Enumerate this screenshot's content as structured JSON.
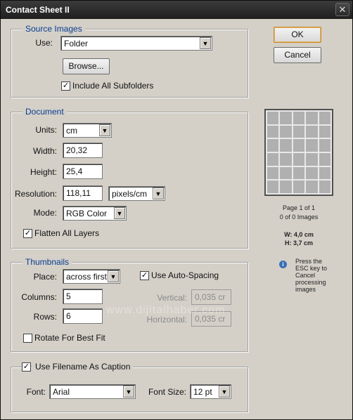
{
  "window": {
    "title": "Contact Sheet II",
    "close_glyph": "✕"
  },
  "buttons": {
    "ok": "OK",
    "cancel": "Cancel"
  },
  "source": {
    "legend": "Source Images",
    "use_label": "Use:",
    "use_value": "Folder",
    "browse": "Browse...",
    "include_subfolders_label": "Include All Subfolders",
    "include_subfolders_checked": true
  },
  "document": {
    "legend": "Document",
    "units_label": "Units:",
    "units_value": "cm",
    "width_label": "Width:",
    "width_value": "20,32",
    "height_label": "Height:",
    "height_value": "25,4",
    "resolution_label": "Resolution:",
    "resolution_value": "118,11",
    "resolution_unit": "pixels/cm",
    "mode_label": "Mode:",
    "mode_value": "RGB Color",
    "flatten_label": "Flatten All Layers",
    "flatten_checked": true
  },
  "thumbnails": {
    "legend": "Thumbnails",
    "place_label": "Place:",
    "place_value": "across first",
    "auto_spacing_label": "Use Auto-Spacing",
    "auto_spacing_checked": true,
    "columns_label": "Columns:",
    "columns_value": "5",
    "rows_label": "Rows:",
    "rows_value": "6",
    "vertical_label": "Vertical:",
    "vertical_value": "0,035 cr",
    "horizontal_label": "Horizontal:",
    "horizontal_value": "0,035 cr",
    "rotate_label": "Rotate For Best Fit",
    "rotate_checked": false
  },
  "caption": {
    "use_filename_label": "Use Filename As Caption",
    "use_filename_checked": true,
    "font_label": "Font:",
    "font_value": "Arial",
    "font_size_label": "Font Size:",
    "font_size_value": "12 pt"
  },
  "preview": {
    "page_info": "Page 1 of 1",
    "images_info": "0 of 0 Images",
    "w_info": "W: 4,0 cm",
    "h_info": "H: 3,7 cm",
    "hint": "Press the ESC key to Cancel processing images",
    "grid_columns": 5,
    "grid_rows": 6
  },
  "watermark": "www.dijitalhaber.com",
  "icons": {
    "dropdown": "chevron-down-icon",
    "check": "check-icon",
    "info": "info-icon"
  }
}
